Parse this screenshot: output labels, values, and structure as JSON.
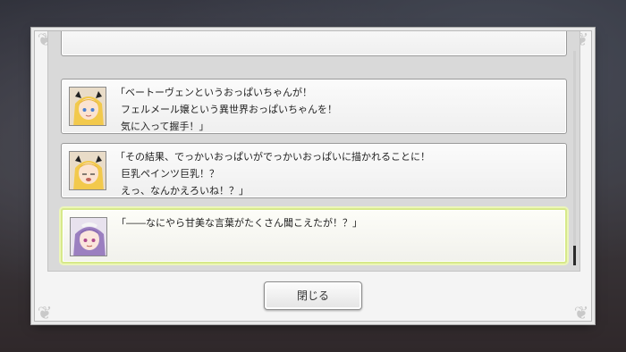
{
  "dialog_log": {
    "entries": [
      {
        "speaker_avatar": "blonde-girl-avatar",
        "lines": [
          "「ベートーヴェンというおっぱいちゃんが！",
          "フェルメール嬢という異世界おっぱいちゃんを！",
          "気に入って握手！」"
        ]
      },
      {
        "speaker_avatar": "blonde-girl-avatar",
        "lines": [
          "「その結果、でっかいおっぱいがでっかいおっぱいに描かれることに！",
          "巨乳ペインツ巨乳！？",
          "えっ、なんかえろいね！？」"
        ]
      },
      {
        "speaker_avatar": "purple-hair-girl-avatar",
        "lines": [
          "「――なにやら甘美な言葉がたくさん聞こえたが！？」"
        ]
      }
    ]
  },
  "buttons": {
    "close_label": "閉じる"
  },
  "colors": {
    "highlight_border": "#d7e98a",
    "panel_bg": "#d9d9d9"
  }
}
